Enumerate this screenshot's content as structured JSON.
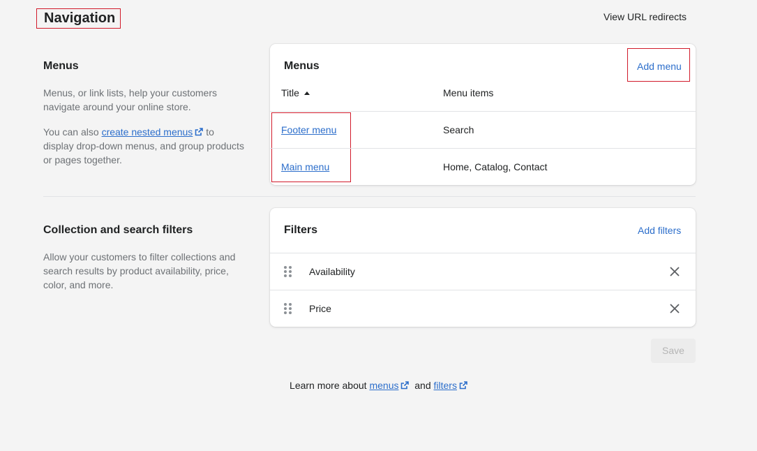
{
  "page": {
    "title": "Navigation",
    "url_redirects_label": "View URL redirects"
  },
  "menus_section": {
    "title": "Menus",
    "desc1": "Menus, or link lists, help your customers navigate around your online store.",
    "desc2_prefix": "You can also",
    "desc2_link": "create nested menus",
    "desc2_suffix": "to display drop-down menus, and group products or pages together."
  },
  "menus_card": {
    "title": "Menus",
    "add_label": "Add menu",
    "col_title": "Title",
    "col_items": "Menu items",
    "rows": [
      {
        "title": "Footer menu",
        "items": "Search"
      },
      {
        "title": "Main menu",
        "items": "Home, Catalog, Contact"
      }
    ]
  },
  "filters_section": {
    "title": "Collection and search filters",
    "desc": "Allow your customers to filter collections and search results by product availability, price, color, and more."
  },
  "filters_card": {
    "title": "Filters",
    "add_label": "Add filters",
    "rows": [
      {
        "label": "Availability"
      },
      {
        "label": "Price"
      }
    ]
  },
  "save_label": "Save",
  "footer": {
    "prefix": "Learn more about",
    "link1": "menus",
    "middle": "and",
    "link2": "filters"
  },
  "icons": {
    "external_link": "external-link-icon",
    "sort_asc": "sort-ascending-icon",
    "drag": "drag-handle-icon",
    "close": "close-icon"
  },
  "colors": {
    "link": "#2c6ecb",
    "highlight": "#d11a2a",
    "background": "#f4f4f4"
  }
}
